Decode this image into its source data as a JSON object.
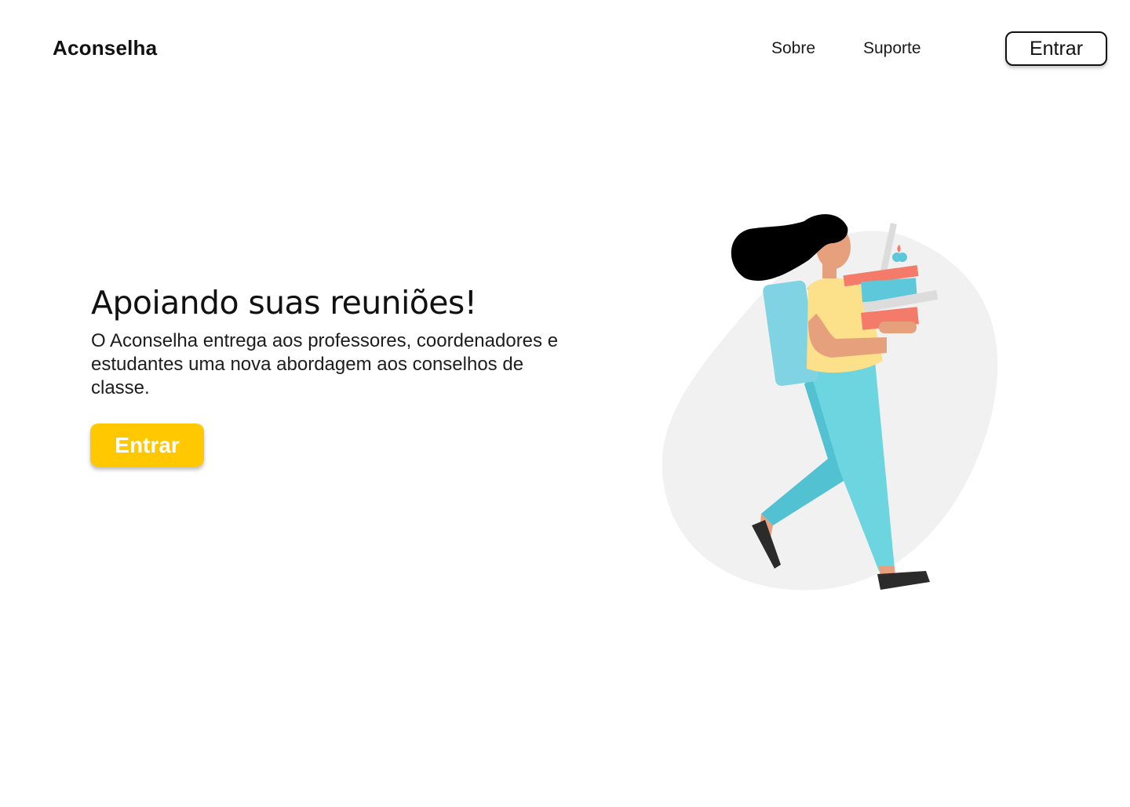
{
  "header": {
    "brand": "Aconselha",
    "nav": {
      "about": "Sobre",
      "support": "Suporte"
    },
    "login_label": "Entrar"
  },
  "hero": {
    "title": "Apoiando suas reuniões!",
    "description": "O Aconselha entrega aos professores,  coordenadores e estudantes uma nova abordagem aos conselhos de classe.",
    "cta_label": "Entrar"
  },
  "colors": {
    "accent": "#ffc800",
    "blob": "#f1f1f1",
    "hair": "#000000",
    "skin": "#e6a07c",
    "shirt": "#fde08a",
    "pants": "#6cd5e0",
    "backpack": "#7fd3e3",
    "shoes": "#2b2b2b",
    "book_red": "#f47a6a",
    "book_blue": "#5dc8d9"
  },
  "illustration": {
    "icon": "student-carrying-books-illustration"
  }
}
